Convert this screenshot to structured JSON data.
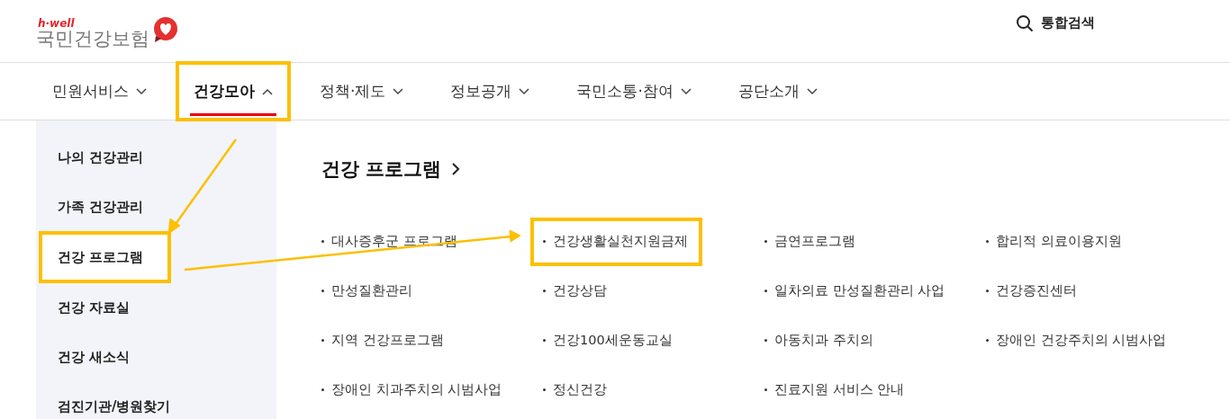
{
  "header": {
    "logo": {
      "tagline": "h·well",
      "name": "국민건강보험"
    },
    "search_label": "통합검색"
  },
  "nav": [
    {
      "label": "민원서비스",
      "selected": false,
      "expanded": false,
      "highlighted": false
    },
    {
      "label": "건강모아",
      "selected": true,
      "expanded": true,
      "highlighted": true
    },
    {
      "label": "정책·제도",
      "selected": false,
      "expanded": false,
      "highlighted": false
    },
    {
      "label": "정보공개",
      "selected": false,
      "expanded": false,
      "highlighted": false
    },
    {
      "label": "국민소통·참여",
      "selected": false,
      "expanded": false,
      "highlighted": false
    },
    {
      "label": "공단소개",
      "selected": false,
      "expanded": false,
      "highlighted": false
    }
  ],
  "sidebar": {
    "items": [
      {
        "label": "나의 건강관리",
        "selected": false,
        "highlighted": false
      },
      {
        "label": "가족 건강관리",
        "selected": false,
        "highlighted": false
      },
      {
        "label": "건강 프로그램",
        "selected": true,
        "highlighted": true
      },
      {
        "label": "건강 자료실",
        "selected": false,
        "highlighted": false
      },
      {
        "label": "건강 새소식",
        "selected": false,
        "highlighted": false
      },
      {
        "label": "검진기관/병원찾기",
        "selected": false,
        "highlighted": false
      }
    ]
  },
  "content": {
    "title": "건강 프로그램",
    "links": [
      {
        "label": "대사증후군 프로그램",
        "highlighted": false
      },
      {
        "label": "건강생활실천지원금제",
        "highlighted": true
      },
      {
        "label": "금연프로그램",
        "highlighted": false
      },
      {
        "label": "합리적 의료이용지원",
        "highlighted": false
      },
      {
        "label": "만성질환관리",
        "highlighted": false
      },
      {
        "label": "건강상담",
        "highlighted": false
      },
      {
        "label": "일차의료 만성질환관리 사업",
        "highlighted": false
      },
      {
        "label": "건강증진센터",
        "highlighted": false
      },
      {
        "label": "지역 건강프로그램",
        "highlighted": false
      },
      {
        "label": "건강100세운동교실",
        "highlighted": false
      },
      {
        "label": "아동치과 주치의",
        "highlighted": false
      },
      {
        "label": "장애인 건강주치의 시범사업",
        "highlighted": false
      },
      {
        "label": "장애인 치과주치의 시범사업",
        "highlighted": false
      },
      {
        "label": "정신건강",
        "highlighted": false
      },
      {
        "label": "진료지원 서비스 안내",
        "highlighted": false
      }
    ]
  }
}
